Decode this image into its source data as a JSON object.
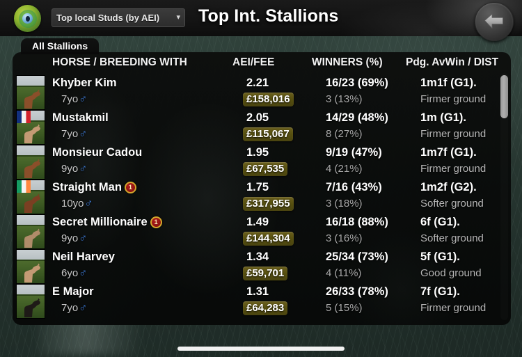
{
  "header": {
    "title": "Top Int. Stallions",
    "logo_icon": "eye-target-logo-icon",
    "mode_select": {
      "value": "Top local Studs (by AEI)",
      "chevron_icon": "chevron-down-icon"
    },
    "back_button": {
      "icon": "back-arrow-icon",
      "label": "Back"
    }
  },
  "tabs": [
    {
      "label": "All Stallions",
      "active": true
    }
  ],
  "table": {
    "columns": [
      {
        "key": "horse",
        "label": "HORSE / BREEDING WITH"
      },
      {
        "key": "aei",
        "label": "AEI/FEE"
      },
      {
        "key": "winners",
        "label": "WINNERS (%)"
      },
      {
        "key": "pdg",
        "label": "Pdg. AvWin / DIST"
      }
    ],
    "rows": [
      {
        "name": "Khyber Kim",
        "badge": null,
        "age": "7yo",
        "sex_icon": "male-symbol-icon",
        "aei": "2.21",
        "fee": "£158,016",
        "winners": "16/23 (69%)",
        "winners_sub": "3 (13%)",
        "pdg": "1m1f  (G1).",
        "pdg_sub": "Firmer ground",
        "thumb": {
          "icon": "horse-photo-thumbnail",
          "flag": null,
          "horse_color": "#8a4f2a"
        }
      },
      {
        "name": "Mustakmil",
        "badge": null,
        "age": "7yo",
        "sex_icon": "male-symbol-icon",
        "aei": "2.05",
        "fee": "£115,067",
        "winners": "14/29 (48%)",
        "winners_sub": "8 (27%)",
        "pdg": "1m  (G1).",
        "pdg_sub": "Firmer ground",
        "thumb": {
          "icon": "horse-photo-thumbnail",
          "flag": "flag-fr",
          "horse_color": "#c49a74"
        }
      },
      {
        "name": "Monsieur Cadou",
        "badge": null,
        "age": "9yo",
        "sex_icon": "male-symbol-icon",
        "aei": "1.95",
        "fee": "£67,535",
        "winners": "9/19 (47%)",
        "winners_sub": "4 (21%)",
        "pdg": "1m7f  (G1).",
        "pdg_sub": "Firmer ground",
        "thumb": {
          "icon": "horse-photo-thumbnail",
          "flag": null,
          "horse_color": "#8a4f2a"
        }
      },
      {
        "name": "Straight Man",
        "badge": "1",
        "age": "10yo",
        "sex_icon": "male-symbol-icon",
        "aei": "1.75",
        "fee": "£317,955",
        "winners": "7/16 (43%)",
        "winners_sub": "3 (18%)",
        "pdg": "1m2f  (G2).",
        "pdg_sub": "Softer ground",
        "thumb": {
          "icon": "horse-photo-thumbnail",
          "flag": "flag-ie",
          "horse_color": "#7a3f22"
        }
      },
      {
        "name": "Secret Millionaire",
        "badge": "1",
        "age": "9yo",
        "sex_icon": "male-symbol-icon",
        "aei": "1.49",
        "fee": "£144,304",
        "winners": "16/18 (88%)",
        "winners_sub": "3 (16%)",
        "pdg": "6f  (G1).",
        "pdg_sub": "Softer ground",
        "thumb": {
          "icon": "horse-photo-thumbnail",
          "flag": null,
          "horse_color": "#b08c6a"
        }
      },
      {
        "name": "Neil Harvey",
        "badge": null,
        "age": "6yo",
        "sex_icon": "male-symbol-icon",
        "aei": "1.34",
        "fee": "£59,701",
        "winners": "25/34 (73%)",
        "winners_sub": "4 (11%)",
        "pdg": "5f  (G1).",
        "pdg_sub": "Good ground",
        "thumb": {
          "icon": "horse-photo-thumbnail",
          "flag": null,
          "horse_color": "#c49a74"
        }
      },
      {
        "name": "E Major",
        "badge": null,
        "age": "7yo",
        "sex_icon": "male-symbol-icon",
        "aei": "1.31",
        "fee": "£64,283",
        "winners": "26/33 (78%)",
        "winners_sub": "5 (15%)",
        "pdg": "7f  (G1).",
        "pdg_sub": "Firmer ground",
        "thumb": {
          "icon": "horse-photo-thumbnail",
          "flag": null,
          "horse_color": "#1e1a17"
        }
      }
    ]
  },
  "scrollbar": {
    "icon": "vertical-scrollbar",
    "thumb_position": "top"
  },
  "home_indicator": {
    "icon": "home-indicator-bar"
  },
  "colors": {
    "accent_gold": "#57500f",
    "badge_red": "#8d1313",
    "badge_rim_gold": "#d4a72c",
    "male_blue": "#3f7fe0",
    "background_green": "#2a3a34"
  }
}
